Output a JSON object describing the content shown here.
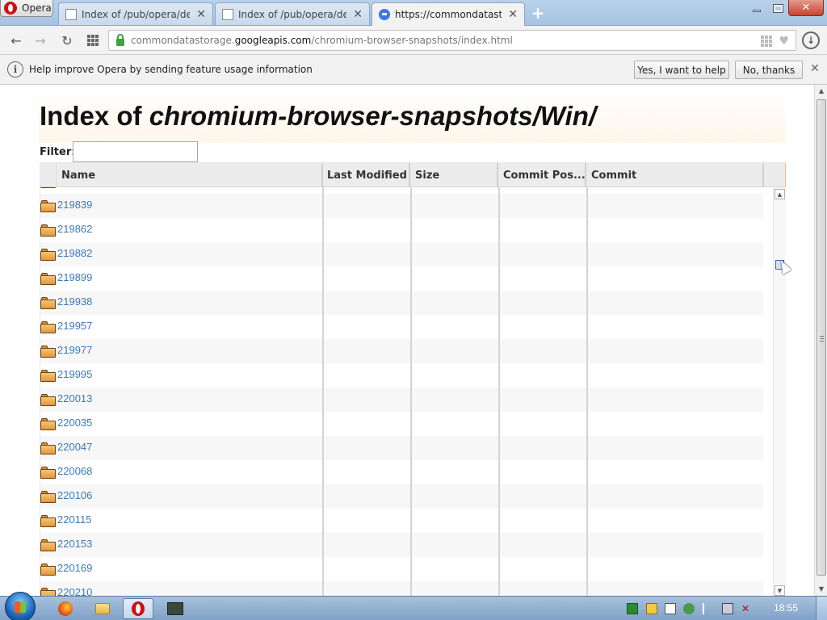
{
  "window": {
    "opera_button_label": "Opera",
    "minimize_label": "minimize",
    "maximize_label": "maximize",
    "close_label": "✕"
  },
  "tabs": [
    {
      "title": "Index of /pub/opera/desk",
      "active": false
    },
    {
      "title": "Index of /pub/opera/desk",
      "active": false
    },
    {
      "title": "https://commondatastorag",
      "active": true
    }
  ],
  "navbar": {
    "url_prefix": "commondatastorage.",
    "url_host": "googleapis.com",
    "url_path": "/chromium-browser-snapshots/index.html"
  },
  "infobar": {
    "text": "Help improve Opera by sending feature usage information",
    "yes_button": "Yes, I want to help",
    "no_button": "No, thanks"
  },
  "page": {
    "title_prefix": "Index of ",
    "title_path": "chromium-browser-snapshots/Win/",
    "filter_label": "Filter:",
    "filter_value": ""
  },
  "table": {
    "columns": [
      "Name",
      "Last Modified",
      "Size",
      "Commit Pos...",
      "Commit"
    ],
    "rows": [
      {
        "name": "219839"
      },
      {
        "name": "219862"
      },
      {
        "name": "219882"
      },
      {
        "name": "219899"
      },
      {
        "name": "219938"
      },
      {
        "name": "219957"
      },
      {
        "name": "219977"
      },
      {
        "name": "219995"
      },
      {
        "name": "220013"
      },
      {
        "name": "220035"
      },
      {
        "name": "220047"
      },
      {
        "name": "220068"
      },
      {
        "name": "220106"
      },
      {
        "name": "220115"
      },
      {
        "name": "220153"
      },
      {
        "name": "220169"
      },
      {
        "name": "220210"
      }
    ]
  },
  "taskbar": {
    "clock": "18:55"
  },
  "colors": {
    "link": "#3d7ab8",
    "header_bg": "#fdf6ea",
    "accent_opera": "#cc0f16"
  }
}
